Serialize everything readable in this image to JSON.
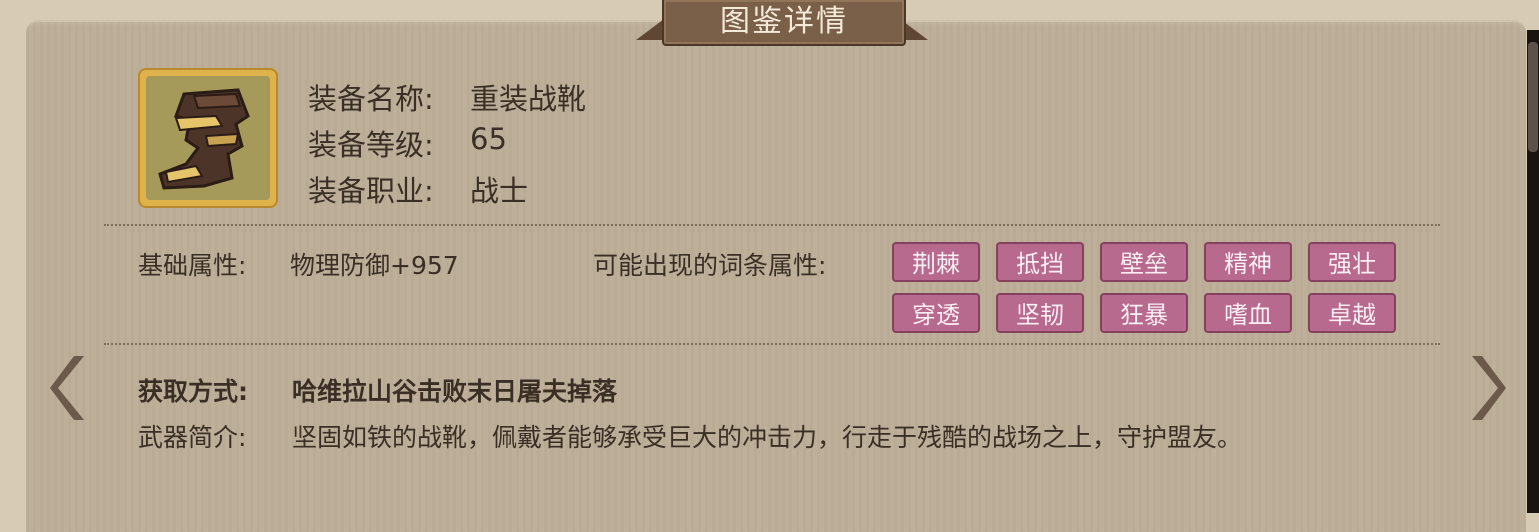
{
  "title": "图鉴详情",
  "equipment": {
    "name_label": "装备名称:",
    "name_value": "重装战靴",
    "level_label": "装备等级:",
    "level_value": "65",
    "class_label": "装备职业:",
    "class_value": "战士",
    "icon": "armored-boots-icon"
  },
  "attributes": {
    "base_label": "基础属性:",
    "base_value": "物理防御+957",
    "affix_label": "可能出现的词条属性:",
    "affixes": [
      "荆棘",
      "抵挡",
      "壁垒",
      "精神",
      "强壮",
      "穿透",
      "坚韧",
      "狂暴",
      "嗜血",
      "卓越"
    ]
  },
  "source": {
    "label": "获取方式:",
    "value": "哈维拉山谷击败末日屠夫掉落"
  },
  "description": {
    "label": "武器简介:",
    "value": "坚固如铁的战靴，佩戴者能够承受巨大的冲击力，行走于残酷的战场之上，守护盟友。"
  },
  "nav": {
    "prev_icon": "chevron-left-icon",
    "next_icon": "chevron-right-icon"
  },
  "colors": {
    "panel": "#bcae97",
    "tag": "#b7698e",
    "text": "#3b2f25",
    "icon_frame": "#e0b24c"
  }
}
